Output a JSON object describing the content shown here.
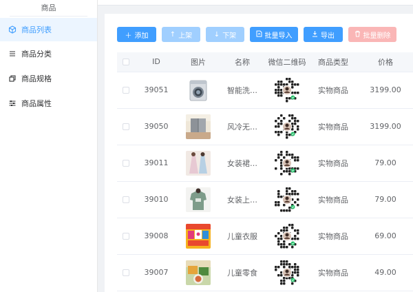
{
  "sidebar": {
    "group_title": "商品",
    "items": [
      {
        "label": "商品列表",
        "icon": "cube-icon",
        "active": true
      },
      {
        "label": "商品分类",
        "icon": "list-icon",
        "active": false
      },
      {
        "label": "商品规格",
        "icon": "copy-icon",
        "active": false
      },
      {
        "label": "商品属性",
        "icon": "sliders-icon",
        "active": false
      }
    ]
  },
  "toolbar": {
    "add": "添加",
    "on_shelf": "上架",
    "off_shelf": "下架",
    "batch_import": "批量导入",
    "export": "导出",
    "batch_delete": "批量删除"
  },
  "table": {
    "headers": [
      "ID",
      "图片",
      "名称",
      "微信二维码",
      "商品类型",
      "价格"
    ],
    "rows": [
      {
        "id": "39051",
        "name": "智能洗…",
        "type": "实物商品",
        "price": "3199.00",
        "image": "washing-machine-image"
      },
      {
        "id": "39050",
        "name": "风冷无…",
        "type": "实物商品",
        "price": "3199.00",
        "image": "refrigerator-image"
      },
      {
        "id": "39011",
        "name": "女装裙…",
        "type": "实物商品",
        "price": "79.00",
        "image": "dress-image"
      },
      {
        "id": "39010",
        "name": "女装上…",
        "type": "实物商品",
        "price": "79.00",
        "image": "womens-top-image"
      },
      {
        "id": "39008",
        "name": "儿童衣服",
        "type": "实物商品",
        "price": "69.00",
        "image": "kids-clothes-image"
      },
      {
        "id": "39007",
        "name": "儿童零食",
        "type": "实物商品",
        "price": "49.00",
        "image": "kids-snacks-image"
      }
    ]
  },
  "colors": {
    "primary": "#409eff",
    "primary_disabled": "#a0cfff",
    "danger_disabled": "#fab6b6",
    "active_bg": "#ecf5ff"
  }
}
